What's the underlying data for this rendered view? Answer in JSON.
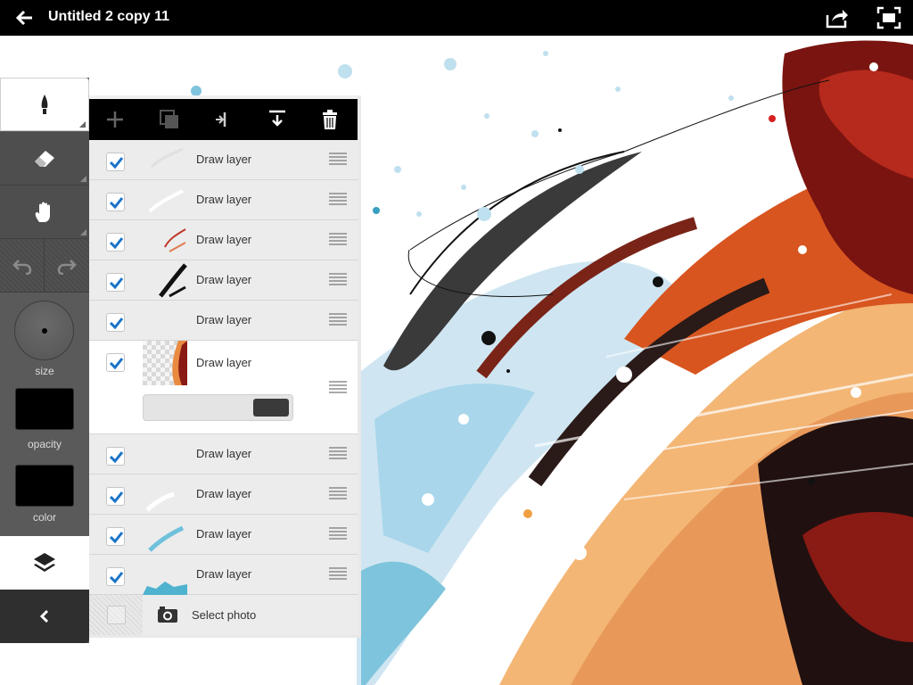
{
  "app": {
    "title": "Untitled 2 copy 11"
  },
  "topbar": {
    "back_icon": "arrow-left-icon",
    "share_icon": "share-icon",
    "fullscreen_icon": "fullscreen-icon"
  },
  "tools": {
    "items": [
      {
        "id": "brush",
        "icon": "brush-icon",
        "selected": true
      },
      {
        "id": "eraser",
        "icon": "eraser-icon"
      },
      {
        "id": "hand",
        "icon": "hand-icon"
      }
    ],
    "size_label": "size",
    "opacity_label": "opacity",
    "color_label": "color",
    "current_color": "#000000",
    "current_opacity_swatch": "#000000"
  },
  "layers_toolbar": [
    "add-layer-icon",
    "duplicate-layer-icon",
    "merge-layer-icon",
    "merge-down-icon",
    "delete-layer-icon"
  ],
  "layers": [
    {
      "name": "Draw layer",
      "visible": true
    },
    {
      "name": "Draw layer",
      "visible": true
    },
    {
      "name": "Draw layer",
      "visible": true
    },
    {
      "name": "Draw layer",
      "visible": true
    },
    {
      "name": "Draw layer",
      "visible": true
    },
    {
      "name": "Draw layer",
      "visible": true,
      "expanded": true
    },
    {
      "name": "Draw layer",
      "visible": true
    },
    {
      "name": "Draw layer",
      "visible": true
    },
    {
      "name": "Draw layer",
      "visible": true
    },
    {
      "name": "Draw layer",
      "visible": true
    }
  ],
  "photo_row": {
    "label": "Select photo"
  },
  "colors": {
    "accent_check": "#1a73c6",
    "topbar": "#000000",
    "panel_dark": "#4e4e4e"
  }
}
